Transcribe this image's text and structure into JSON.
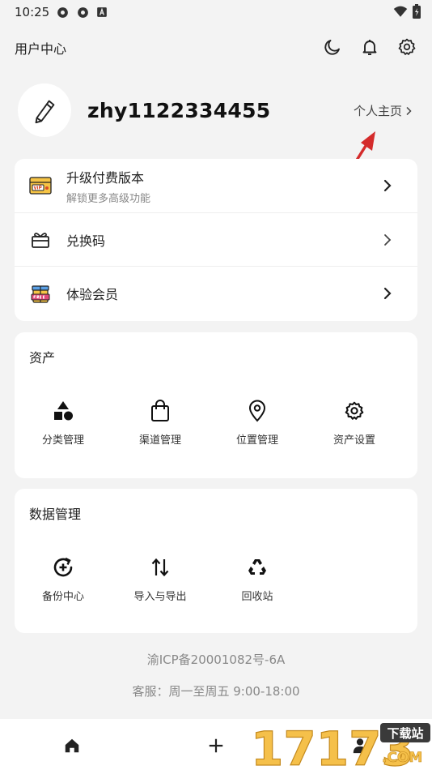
{
  "status_bar": {
    "time": "10:25",
    "icons": [
      "settings-gear-icon",
      "settings-gear-icon",
      "font-a-icon",
      "wifi-icon",
      "battery-icon"
    ]
  },
  "header": {
    "title": "用户中心",
    "actions": [
      "moon-icon",
      "bell-icon",
      "gear-icon"
    ]
  },
  "profile": {
    "username": "zhy1122334455",
    "homepage_link": "个人主页"
  },
  "menu": [
    {
      "label": "升级付费版本",
      "subtitle": "解锁更多高级功能",
      "icon": "vip-ticket-icon"
    },
    {
      "label": "兑换码",
      "subtitle": "",
      "icon": "gift-box-icon"
    },
    {
      "label": "体验会员",
      "subtitle": "",
      "icon": "free-gift-icon"
    }
  ],
  "assets": {
    "title": "资产",
    "items": [
      {
        "label": "分类管理",
        "icon": "shapes-icon"
      },
      {
        "label": "渠道管理",
        "icon": "shopping-bag-icon"
      },
      {
        "label": "位置管理",
        "icon": "location-pin-icon"
      },
      {
        "label": "资产设置",
        "icon": "gear-icon"
      }
    ]
  },
  "data_management": {
    "title": "数据管理",
    "items": [
      {
        "label": "备份中心",
        "icon": "backup-icon"
      },
      {
        "label": "导入与导出",
        "icon": "import-export-icon"
      },
      {
        "label": "回收站",
        "icon": "recycle-icon"
      }
    ]
  },
  "footer": {
    "icp": "渝ICP备20001082号-6A",
    "service": "客服：周一至周五 9:00-18:00"
  },
  "bottom_nav": [
    "home-icon",
    "add-icon",
    "profile-icon"
  ],
  "watermark": {
    "number": "17173",
    "badge": "下载站",
    "domain": ".COM"
  },
  "colors": {
    "background": "#f3f3f3",
    "card": "#ffffff",
    "arrow": "#d42b2b",
    "watermark_gold": "#f5c04a"
  }
}
